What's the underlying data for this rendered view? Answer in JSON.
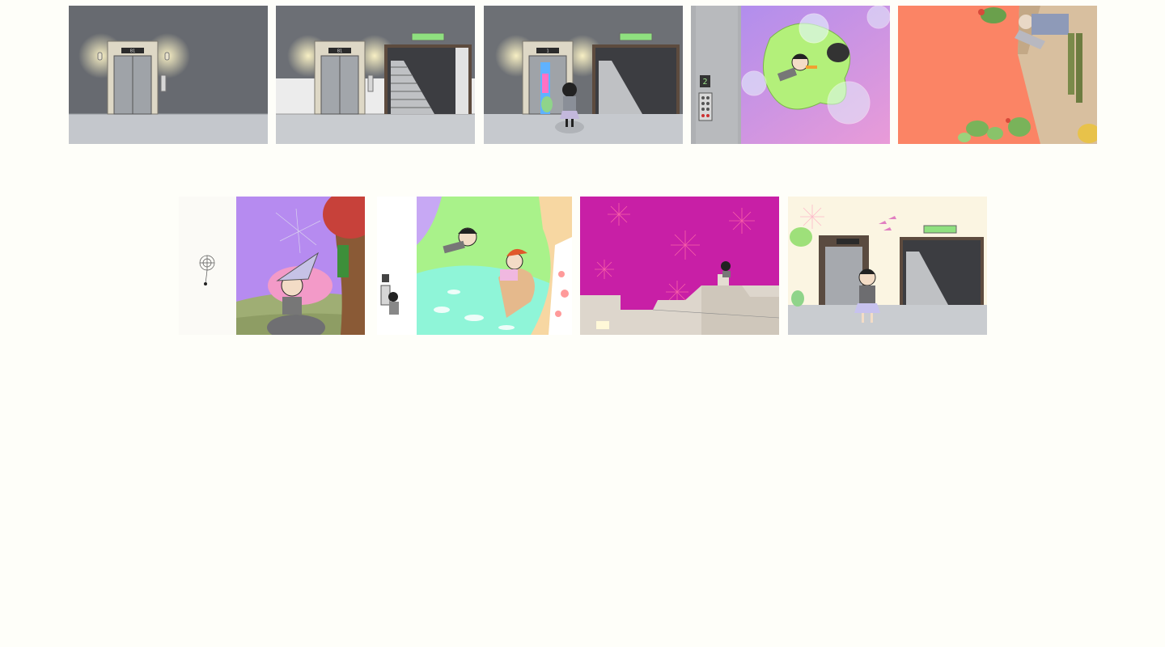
{
  "page": {
    "background": "#fefef9"
  },
  "gallery": {
    "row1": [
      {
        "id": "elevator-lobby-dark",
        "icon": "illustration-elevator-lobby",
        "floor_label": "B1"
      },
      {
        "id": "elevator-and-stairs",
        "icon": "illustration-elevator-stairs",
        "floor_label": "B1"
      },
      {
        "id": "girl-at-elevator",
        "icon": "illustration-girl-at-elevator",
        "floor_label": "1"
      },
      {
        "id": "girl-flying-with-frog",
        "icon": "illustration-girl-frog-bubbles",
        "floor_label": "2"
      },
      {
        "id": "cactus-and-old-man",
        "icon": "illustration-cactus-old-man"
      }
    ],
    "row2": [
      {
        "id": "spider-web-and-witch-hat",
        "icon": "illustration-spider-witch-hat"
      },
      {
        "id": "elevator-panel-and-slide",
        "icon": "illustration-slide-fall"
      },
      {
        "id": "fireworks-rooftops",
        "icon": "illustration-fireworks"
      },
      {
        "id": "girl-returning-elevator",
        "icon": "illustration-girl-return"
      }
    ]
  },
  "colors": {
    "concrete": "#6d7075",
    "floor": "#c9ccd0",
    "coral": "#fb8465",
    "violet": "#b68bf0",
    "magenta": "#c81fa6",
    "lime": "#a9f28a",
    "mint": "#8ff5d8",
    "cream": "#fbf5e2"
  }
}
